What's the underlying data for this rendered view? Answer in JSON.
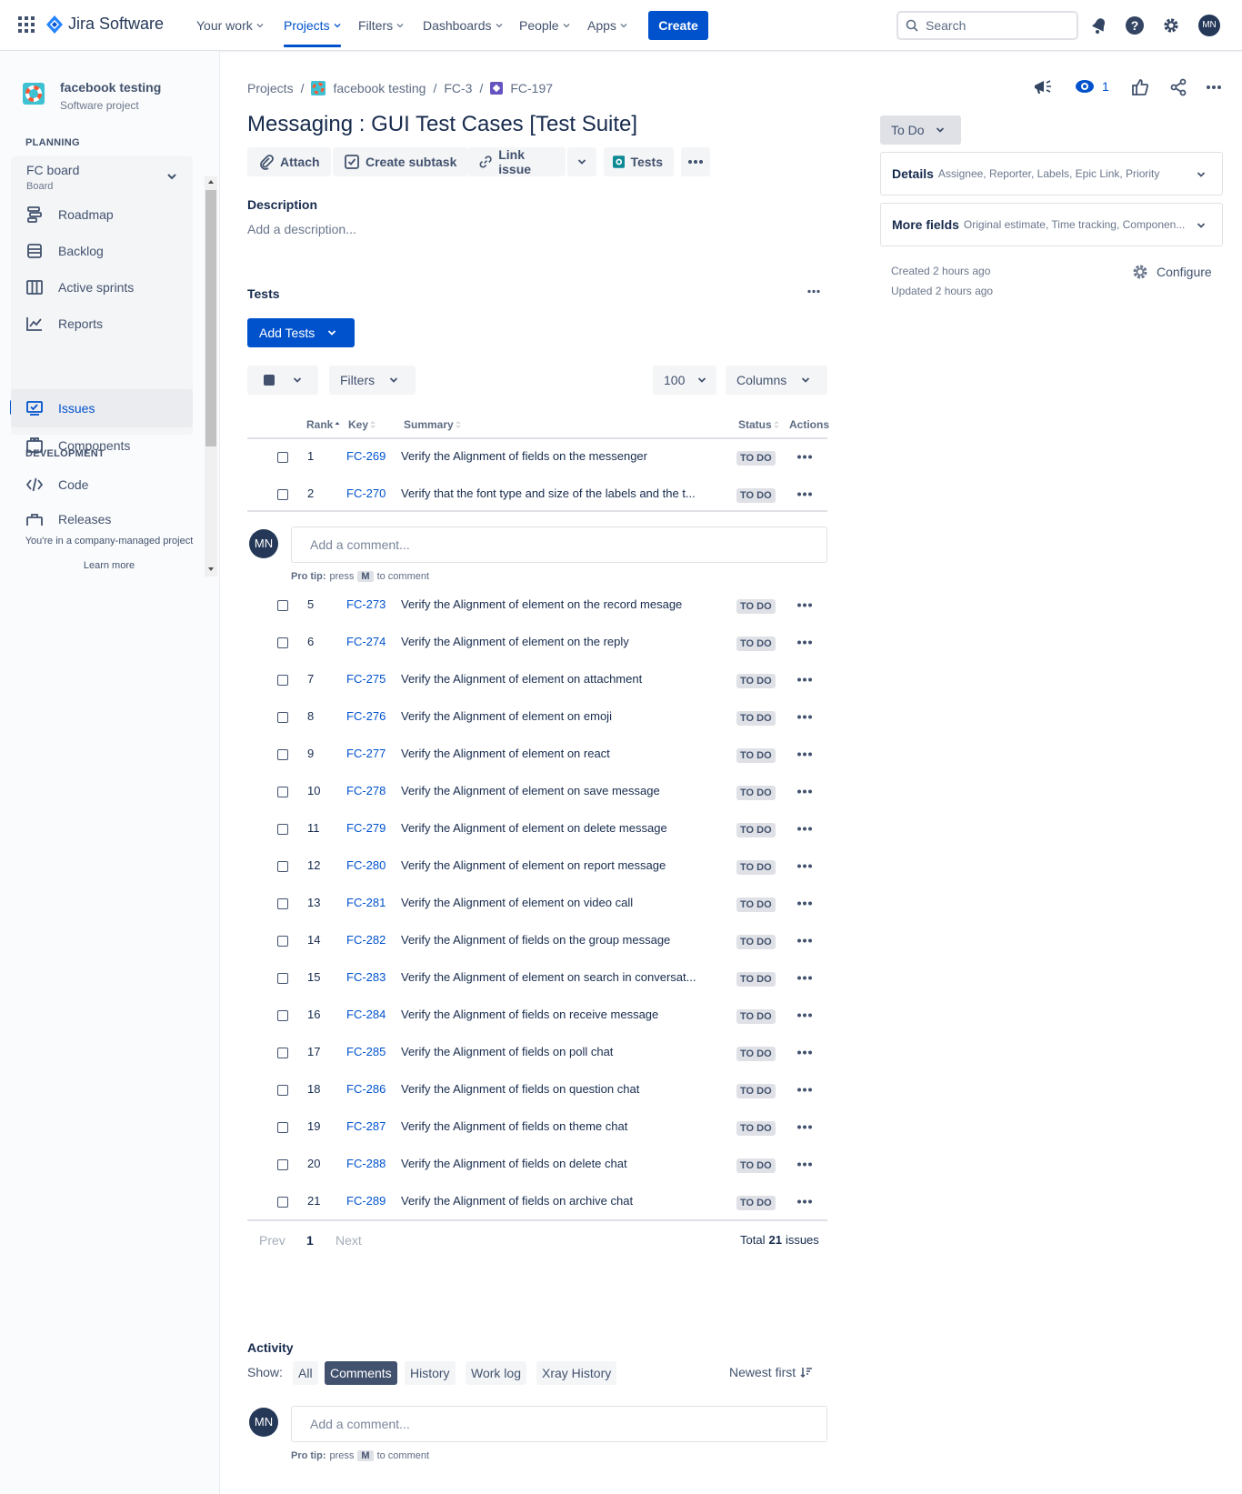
{
  "topnav": {
    "product_name": "Jira Software",
    "items": [
      "Your work",
      "Projects",
      "Filters",
      "Dashboards",
      "People",
      "Apps"
    ],
    "create_label": "Create",
    "search_placeholder": "Search",
    "user_initials": "MN",
    "accent": "#0052cc"
  },
  "sidebar": {
    "project_name": "facebook testing",
    "project_type": "Software project",
    "planning_heading": "PLANNING",
    "board_name": "FC board",
    "board_sub": "Board",
    "planning_items": [
      "Roadmap",
      "Backlog",
      "Active sprints",
      "Reports"
    ],
    "issues_label": "Issues",
    "components_label": "Components",
    "development_heading": "DEVELOPMENT",
    "dev_items": [
      "Code",
      "Releases"
    ],
    "footer_text": "You're in a company-managed project",
    "learn_more": "Learn more"
  },
  "breadcrumb": [
    "Projects",
    "facebook testing",
    "FC-3",
    "FC-197"
  ],
  "issue": {
    "title": "Messaging : GUI Test Cases [Test Suite]",
    "toolbar": {
      "attach": "Attach",
      "create_subtask": "Create subtask",
      "link_issue": "Link issue",
      "tests": "Tests"
    },
    "description_label": "Description",
    "description_placeholder": "Add a description..."
  },
  "tests_section": {
    "heading": "Tests",
    "add_tests": "Add Tests",
    "filters_label": "Filters",
    "page_size": "100",
    "columns_label": "Columns",
    "headers": {
      "rank": "Rank",
      "key": "Key",
      "summary": "Summary",
      "status": "Status",
      "actions": "Actions"
    },
    "rows_top": [
      {
        "rank": "1",
        "key": "FC-269",
        "summary": "Verify the Alignment of fields on the messenger",
        "status": "TO DO"
      },
      {
        "rank": "2",
        "key": "FC-270",
        "summary": "Verify that the font type and size of the labels and the t...",
        "status": "TO DO"
      }
    ],
    "rows_bottom": [
      {
        "rank": "5",
        "key": "FC-273",
        "summary": "Verify the Alignment of element on the record mesage",
        "status": "TO DO"
      },
      {
        "rank": "6",
        "key": "FC-274",
        "summary": "Verify the Alignment of element on the reply",
        "status": "TO DO"
      },
      {
        "rank": "7",
        "key": "FC-275",
        "summary": "Verify the Alignment of element on attachment",
        "status": "TO DO"
      },
      {
        "rank": "8",
        "key": "FC-276",
        "summary": "Verify the Alignment of element on emoji",
        "status": "TO DO"
      },
      {
        "rank": "9",
        "key": "FC-277",
        "summary": "Verify the Alignment of element on react",
        "status": "TO DO"
      },
      {
        "rank": "10",
        "key": "FC-278",
        "summary": "Verify the Alignment of element on save message",
        "status": "TO DO"
      },
      {
        "rank": "11",
        "key": "FC-279",
        "summary": "Verify the Alignment of element on delete message",
        "status": "TO DO"
      },
      {
        "rank": "12",
        "key": "FC-280",
        "summary": "Verify the Alignment of element on report message",
        "status": "TO DO"
      },
      {
        "rank": "13",
        "key": "FC-281",
        "summary": "Verify the Alignment of element on video call",
        "status": "TO DO"
      },
      {
        "rank": "14",
        "key": "FC-282",
        "summary": "Verify the Alignment of fields on the group message",
        "status": "TO DO"
      },
      {
        "rank": "15",
        "key": "FC-283",
        "summary": "Verify the Alignment of element on search in conversat...",
        "status": "TO DO"
      },
      {
        "rank": "16",
        "key": "FC-284",
        "summary": "Verify the Alignment of fields on receive message",
        "status": "TO DO"
      },
      {
        "rank": "17",
        "key": "FC-285",
        "summary": "Verify the Alignment of fields on poll chat",
        "status": "TO DO"
      },
      {
        "rank": "18",
        "key": "FC-286",
        "summary": "Verify the Alignment of fields on question chat",
        "status": "TO DO"
      },
      {
        "rank": "19",
        "key": "FC-287",
        "summary": "Verify the Alignment of fields on theme chat",
        "status": "TO DO"
      },
      {
        "rank": "20",
        "key": "FC-288",
        "summary": "Verify the Alignment of fields on delete chat",
        "status": "TO DO"
      },
      {
        "rank": "21",
        "key": "FC-289",
        "summary": "Verify the Alignment of fields on archive chat",
        "status": "TO DO"
      }
    ],
    "pagination": {
      "prev": "Prev",
      "page": "1",
      "next": "Next",
      "total_prefix": "Total",
      "total_count": "21",
      "total_suffix": "issues"
    }
  },
  "comment": {
    "placeholder": "Add a comment...",
    "pro_tip_label": "Pro tip:",
    "pro_tip_press": "press",
    "pro_tip_key": "M",
    "pro_tip_suffix": "to comment"
  },
  "activity": {
    "heading": "Activity",
    "show_label": "Show:",
    "tabs": [
      "All",
      "Comments",
      "History",
      "Work log",
      "Xray History"
    ],
    "active_tab": "Comments",
    "sort_label": "Newest first"
  },
  "right_panel": {
    "watch_count": "1",
    "status_button": "To Do",
    "details_label": "Details",
    "details_hint": "Assignee, Reporter, Labels, Epic Link, Priority",
    "more_fields_label": "More fields",
    "more_fields_hint": "Original estimate, Time tracking, Componen...",
    "created": "Created 2 hours ago",
    "updated": "Updated 2 hours ago",
    "configure": "Configure"
  }
}
